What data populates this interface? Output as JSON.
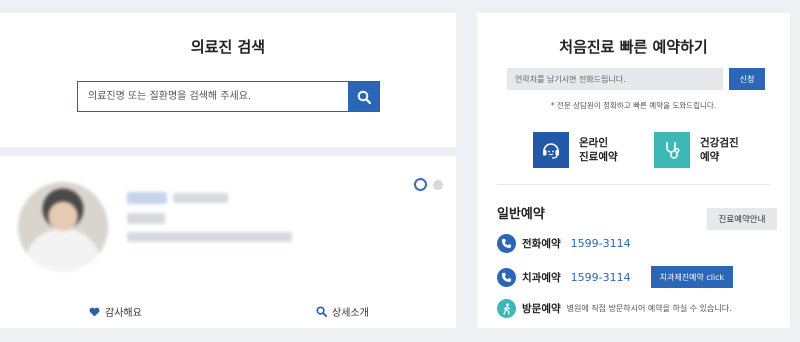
{
  "search": {
    "title": "의료진 검색",
    "placeholder": "의료진명 또는 질환명을 검색해 주세요."
  },
  "doctor_card": {
    "actions": [
      {
        "label": "감사해요",
        "icon": "heart-icon"
      },
      {
        "label": "상세소개",
        "icon": "magnifier-icon"
      }
    ]
  },
  "reservation": {
    "title": "처음진료 빠른 예약하기",
    "phone_placeholder": "연락처를 남기시면 전화드립니다.",
    "apply_label": "신청",
    "notice": "* 전문 상담원이 정확하고 빠른 예약을 도와드립니다.",
    "quick_links": [
      {
        "line1": "온라인",
        "line2": "진료예약",
        "icon": "headset-icon",
        "color": "#2259a8"
      },
      {
        "line1": "건강검진",
        "line2": "예약",
        "icon": "stethoscope-icon",
        "color": "#3cb8b6"
      }
    ],
    "general_title": "일반예약",
    "guide_label": "진료예약안내",
    "phone_label": "전화예약",
    "phone_number": "1599-3114",
    "dental_label": "치과예약",
    "dental_number": "1599-3114",
    "dental_button": "치과제진예약 click",
    "visit_label": "방문예약",
    "visit_desc": "병원에 직접 방문하시어 예약을 하실 수 있습니다."
  },
  "colors": {
    "accent": "#2b66b7",
    "teal": "#3cb8b6",
    "background": "#eef0f3"
  }
}
